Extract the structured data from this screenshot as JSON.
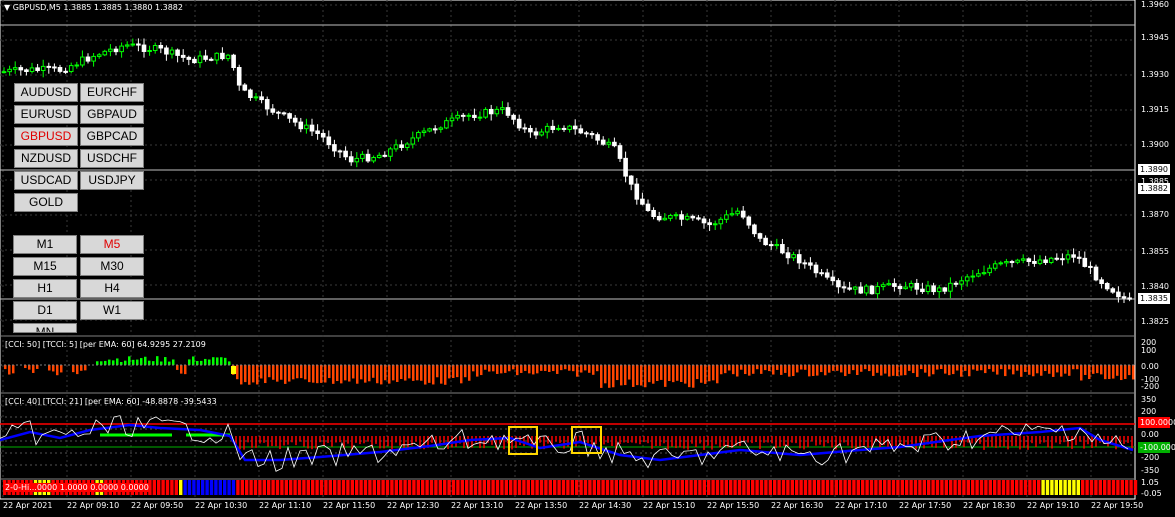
{
  "header": {
    "arrow": "▼",
    "title": "GBPUSD,M5  1.3885 1.3885 1.3880 1.3882"
  },
  "symbols": [
    {
      "label": "AUDUSD",
      "active": false
    },
    {
      "label": "EURCHF",
      "active": false
    },
    {
      "label": "EURUSD",
      "active": false
    },
    {
      "label": "GBPAUD",
      "active": false
    },
    {
      "label": "GBPUSD",
      "active": true
    },
    {
      "label": "GBPCAD",
      "active": false
    },
    {
      "label": "NZDUSD",
      "active": false
    },
    {
      "label": "USDCHF",
      "active": false
    },
    {
      "label": "USDCAD",
      "active": false
    },
    {
      "label": "USDJPY",
      "active": false
    },
    {
      "label": "GOLD",
      "active": false
    }
  ],
  "timeframes": [
    {
      "label": "M1",
      "active": false
    },
    {
      "label": "M5",
      "active": true
    },
    {
      "label": "M15",
      "active": false
    },
    {
      "label": "M30",
      "active": false
    },
    {
      "label": "H1",
      "active": false
    },
    {
      "label": "H4",
      "active": false
    },
    {
      "label": "D1",
      "active": false
    },
    {
      "label": "W1",
      "active": false
    },
    {
      "label": "MN",
      "active": false
    }
  ],
  "price_axis": [
    "1.3960",
    "1.3945",
    "1.3930",
    "1.3915",
    "1.3900",
    "1.3885",
    "1.3870",
    "1.3855",
    "1.3840",
    "1.3825"
  ],
  "price_tags": {
    "line_high": "1.3890",
    "current": "1.3882",
    "line_low": "1.3835"
  },
  "ind1": {
    "label": "[CCI: 50] [TCCI: 5] [per EMA: 60]  64.9295 27.2109",
    "axis": [
      "200",
      "100",
      "0.00",
      "-100",
      "-200"
    ]
  },
  "ind2": {
    "label": "[CCI: 40] [TCCI: 21] [per EMA: 60]  -48.8878 -39.5433",
    "axis": [
      "350",
      "200",
      "100.0000",
      "0.00",
      "-100.0000",
      "-200",
      "-350"
    ],
    "tag_high": "100.0000",
    "tag_low": "-100.0000"
  },
  "ind3": {
    "label": "2-0-Hi...0000 1.0000 0.0000 0.0000",
    "axis": [
      "1.05",
      "-0.05"
    ]
  },
  "time_axis": [
    "22 Apr 2021",
    "22 Apr 09:10",
    "22 Apr 09:50",
    "22 Apr 10:30",
    "22 Apr 11:10",
    "22 Apr 11:50",
    "22 Apr 12:30",
    "22 Apr 13:10",
    "22 Apr 13:50",
    "22 Apr 14:30",
    "22 Apr 15:10",
    "22 Apr 15:50",
    "22 Apr 16:30",
    "22 Apr 17:10",
    "22 Apr 17:50",
    "22 Apr 18:30",
    "22 Apr 19:10",
    "22 Apr 19:50"
  ],
  "colors": {
    "bull": "#00ff00",
    "bear": "#ffffff",
    "grid": "#3a3a3a",
    "hist": "#ff4500",
    "red": "#ff0000",
    "blue": "#0000ff",
    "yellow": "#ffff00",
    "highlight": "#ffd700"
  }
}
